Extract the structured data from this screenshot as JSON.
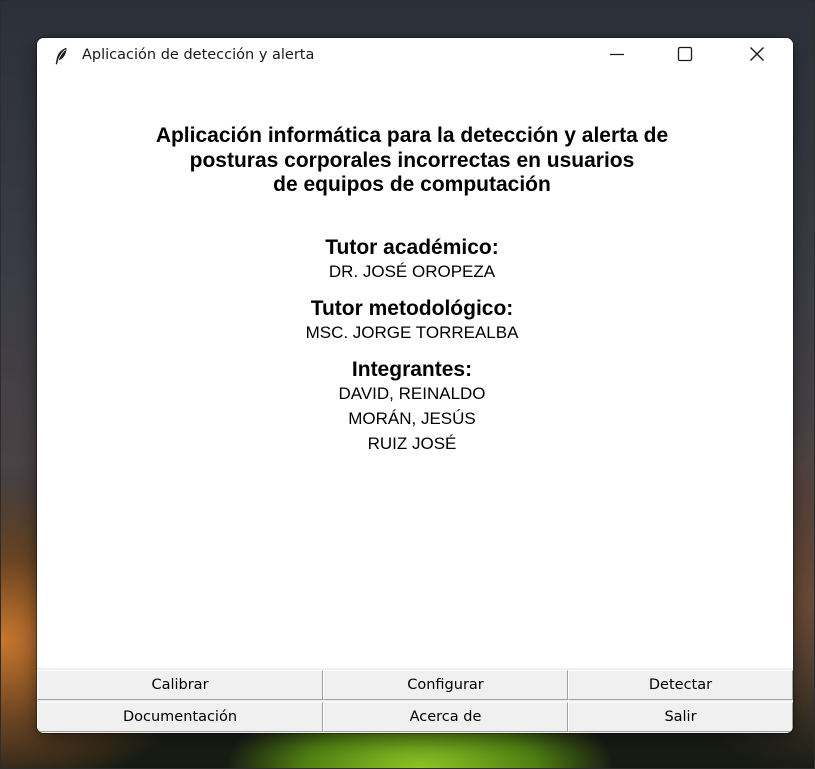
{
  "window": {
    "title": "Aplicación de detección y alerta",
    "icon": "feather-icon",
    "controls": [
      "minimize-icon",
      "maximize-icon",
      "close-icon"
    ]
  },
  "header": {
    "title_lines": [
      "Aplicación informática para la detección y alerta de",
      "posturas corporales incorrectas en usuarios",
      "de equipos de computación"
    ]
  },
  "sections": {
    "academic_tutor": {
      "heading": "Tutor académico:",
      "values": [
        "DR. JOSÉ OROPEZA"
      ]
    },
    "methodological_tutor": {
      "heading": "Tutor metodológico:",
      "values": [
        "MSC. JORGE TORREALBA"
      ]
    },
    "members": {
      "heading": "Integrantes:",
      "values": [
        "DAVID, REINALDO",
        "MORÁN, JESÚS",
        "RUIZ JOSÉ"
      ]
    }
  },
  "buttons": {
    "calibrate": "Calibrar",
    "configure": "Configurar",
    "detect": "Detectar",
    "documentation": "Documentación",
    "about": "Acerca de",
    "exit": "Salir"
  },
  "colors": {
    "window_bg": "#ffffff",
    "button_bg": "#f0f0f0",
    "text": "#000000"
  }
}
